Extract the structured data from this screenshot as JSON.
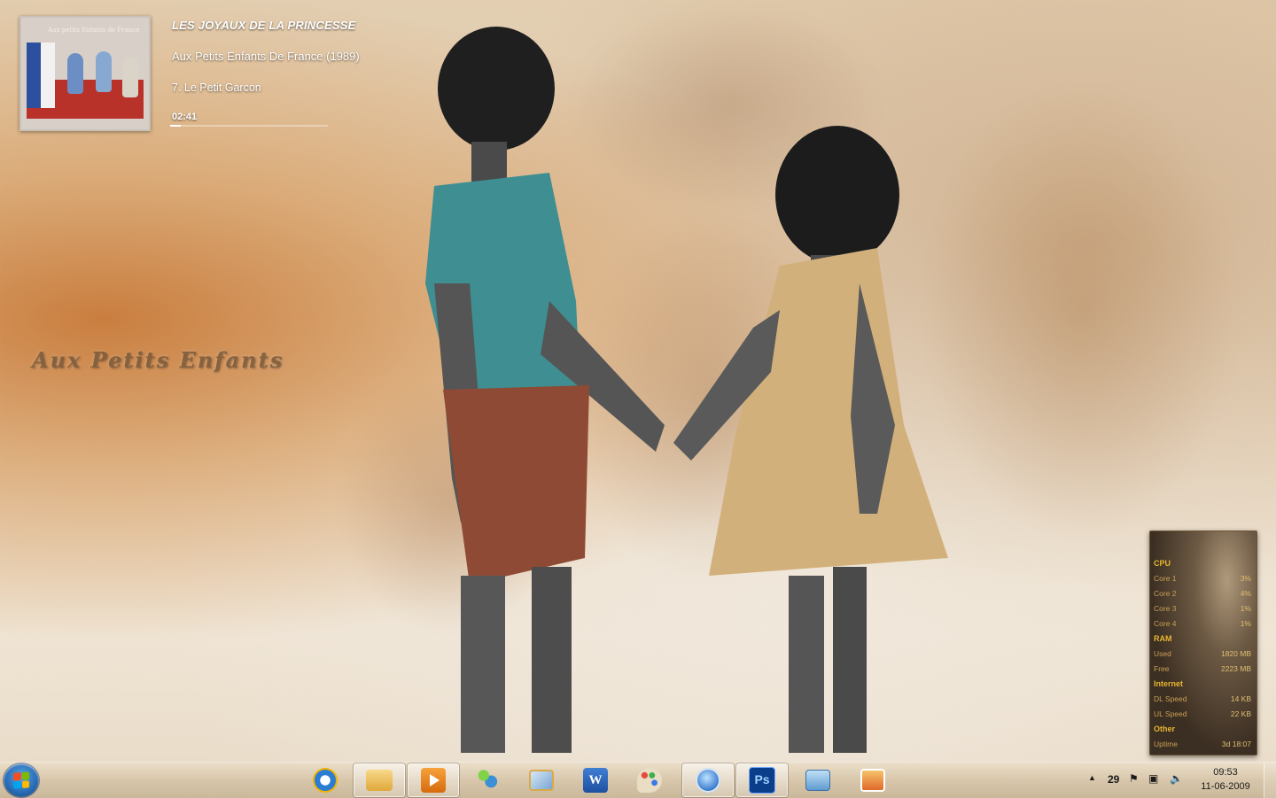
{
  "media_player": {
    "album": "LES JOYAUX DE LA PRINCESSE",
    "artist_line": "Aux Petits Enfants De France (1989)",
    "track": "7. Le Petit Garcon",
    "elapsed": "02:41",
    "progress_fraction": 0.07,
    "album_art_caption": "Aux petits Enfants de France"
  },
  "wallpaper_caption": "Aux Petits Enfants",
  "system_monitor": {
    "cpu_header": "CPU",
    "cores": [
      {
        "label": "Core 1",
        "value": "3%"
      },
      {
        "label": "Core 2",
        "value": "4%"
      },
      {
        "label": "Core 3",
        "value": "1%"
      },
      {
        "label": "Core 4",
        "value": "1%"
      }
    ],
    "ram_header": "RAM",
    "ram": [
      {
        "label": "Used",
        "value": "1820 MB"
      },
      {
        "label": "Free",
        "value": "2223 MB"
      }
    ],
    "internet_header": "Internet",
    "internet": [
      {
        "label": "DL Speed",
        "value": "14 KB"
      },
      {
        "label": "UL Speed",
        "value": "22 KB"
      }
    ],
    "other_header": "Other",
    "other": [
      {
        "label": "Uptime",
        "value": "3d 18:07"
      }
    ]
  },
  "taskbar": {
    "pinned": [
      {
        "name": "internet-explorer",
        "icon": "ie-icon",
        "active": false
      },
      {
        "name": "windows-explorer",
        "icon": "folder-icon",
        "active": true
      },
      {
        "name": "media-player",
        "icon": "media-player-icon",
        "active": true
      },
      {
        "name": "messenger",
        "icon": "messenger-icon",
        "active": false
      },
      {
        "name": "photo-viewer",
        "icon": "photo-icon",
        "active": false
      },
      {
        "name": "word",
        "icon": "word-icon",
        "active": false
      },
      {
        "name": "paint",
        "icon": "paint-palette-icon",
        "active": false
      },
      {
        "name": "browser",
        "icon": "globe-icon",
        "active": true
      },
      {
        "name": "photoshop",
        "icon": "photoshop-icon",
        "active": true
      },
      {
        "name": "control-panel",
        "icon": "control-panel-icon",
        "active": false
      },
      {
        "name": "snipping-tool",
        "icon": "snipping-icon",
        "active": false
      }
    ],
    "photoshop_label": "Ps",
    "tray": {
      "temperature": "29",
      "time": "09:53",
      "date": "11-06-2009"
    }
  },
  "colors": {
    "accent_gold": "#e8b530",
    "shirt_teal": "#3e8e92",
    "shorts_rust": "#8e4a34",
    "dress_tan": "#d2b07c"
  }
}
